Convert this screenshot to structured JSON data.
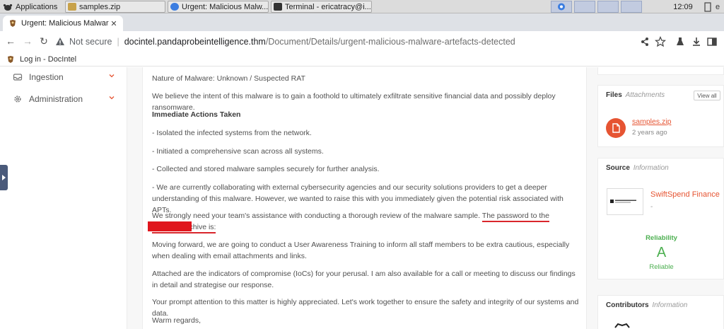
{
  "taskbar": {
    "applications_label": "Applications",
    "tasks": [
      {
        "label": "samples.zip"
      },
      {
        "label": "Urgent: Malicious Malw..."
      },
      {
        "label": "Terminal - ericatracy@i..."
      }
    ],
    "clock": "12:09",
    "user_initial": "e"
  },
  "browser": {
    "tab_title": "Urgent: Malicious Malware",
    "url_security": "Not secure",
    "url_host": "docintel.pandaprobeintelligence.thm",
    "url_path": "/Document/Details/urgent-malicious-malware-artefacts-detected",
    "bookmark_label": "Log in - DocIntel"
  },
  "sidebar": {
    "items": [
      {
        "label": "Ingestion",
        "icon": "inbox-icon"
      },
      {
        "label": "Administration",
        "icon": "gear-icon"
      }
    ]
  },
  "document": {
    "p1": "Nature of Malware: Unknown / Suspected RAT",
    "p2": "We believe the intent of this malware is to gain a foothold to ultimately exfiltrate sensitive financial data and possibly deploy ransomware.",
    "h_actions": "Immediate Actions Taken",
    "a1": "- Isolated the infected systems from the network.",
    "a2": "- Initiated a comprehensive scan across all systems.",
    "a3": "- Collected and stored malware samples securely for further analysis.",
    "a4": "- We are currently collaborating with external cybersecurity agencies and our security solutions providers to get a deeper understanding of this malware. However, we wanted to raise this with you immediately given the potential risk associated with APTs.",
    "p_assist": "We strongly need your team's assistance with conducting a thorough review of the malware sample.",
    "p_password": "The password to the attached archive is:",
    "p_training": "Moving forward, we are going to conduct a User Awareness Training to inform all staff members to be extra cautious, especially when dealing with email attachments and links.",
    "p_iocs": "Attached are the indicators of compromise (IoCs) for your perusal. I am also available for a call or meeting to discuss our findings in detail and strategise our response.",
    "p_prompt": "Your prompt attention to this matter is highly appreciated. Let's work together to ensure the safety and integrity of our systems and data.",
    "p_regards": "Warm regards,"
  },
  "files": {
    "title": "Files",
    "subtitle": "Attachments",
    "view_all": "View all",
    "file_name": "samples.zip",
    "file_time": "2 years ago"
  },
  "source": {
    "title": "Source",
    "subtitle": "Information",
    "name": "SwiftSpend Finance",
    "sub": "-",
    "reliability_label": "Reliability",
    "grade": "A",
    "grade_text": "Reliable"
  },
  "contributors": {
    "title": "Contributors",
    "subtitle": "Information"
  },
  "colors": {
    "accent": "#e65432",
    "reliable_green": "#4caf50",
    "redaction_red": "#e0161d"
  }
}
